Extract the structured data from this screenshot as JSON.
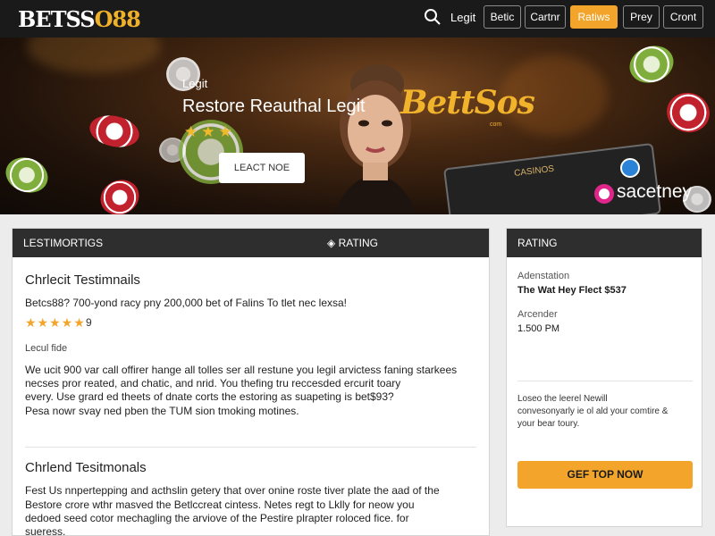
{
  "brand": {
    "logo_white": "BETSS",
    "logo_gold": "O88"
  },
  "nav": {
    "link": "Legit",
    "buttons": [
      "Betic",
      "Cartnr",
      "Ratiws",
      "Prey",
      "Cront"
    ],
    "active_index": 2
  },
  "hero": {
    "subtitle": "Legit",
    "title": "Restore Reauthal Legit",
    "stars": "★★★",
    "cta": "LEACT NOE",
    "brand_big": "BettSos",
    "brand_small": "com",
    "board_label": "CASINOS",
    "partner": "sacetney"
  },
  "main": {
    "header_left": "LESTIMORTIGS",
    "header_right": "RATING",
    "section1": {
      "title": "Chrlecit Testimnails",
      "line": "Betcs88? 700-yond racy pny 200,000 bet of Falins To tlet nec lexsa!",
      "stars": "★★★★★",
      "rating": "9",
      "label": "Lecul fide",
      "paragraph": [
        "We ucit 900 var call offirer hange all tolles ser all restune you legil arvictess faning starkees",
        "necses pror reated, and chatic, and nrid. You thefing tru reccesded ercurit toary",
        "every. Use grard ed theets of dnate corts the estoring as suapeting is bet$93?",
        "Pesa nowr svay ned pben the TUM sion tmoking motines."
      ]
    },
    "section2": {
      "title": "Chrlend Tesitmonals",
      "paragraph": [
        "Fest Us nnpertepping and acthslin getery that over onine roste tiver plate the aad of the",
        "Bestore crore wthr masved the Betlccreat cintess. Netes regt to Lklly for neow you",
        "dedoed seed cotor mechagling the arviove of the Pestire plrapter roloced fice. for",
        "sueress."
      ]
    }
  },
  "side": {
    "header": "RATING",
    "label1": "Adenstation",
    "value1": "The Wat Hey Flect $537",
    "label2": "Arcender",
    "value2": "1.500 PM",
    "note": [
      "Loseo the leerel Newill",
      "convesonyarly ie ol ald your comtire &",
      "your bear toury."
    ],
    "cta": "GEF TOP NOW"
  },
  "colors": {
    "accent": "#f2a52a",
    "dark_header": "#2e2e2e",
    "topbar": "#1a1a1a"
  },
  "icons": [
    "search-icon",
    "partner-logo-icon",
    "info-badge-icon",
    "star-icon"
  ]
}
